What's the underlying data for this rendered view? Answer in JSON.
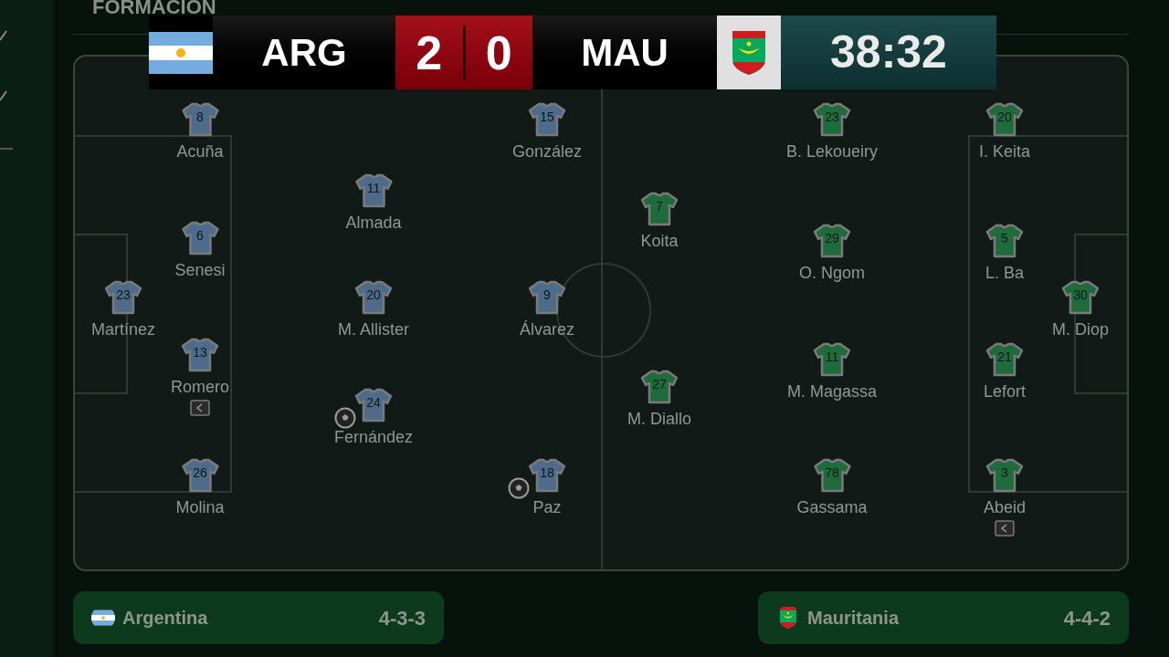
{
  "section_title": "FORMACION",
  "scoreboard": {
    "home": {
      "code": "ARG",
      "score": "2"
    },
    "away": {
      "code": "MAU",
      "score": "0"
    },
    "clock": "38:32"
  },
  "teams": [
    {
      "kind": "home",
      "name": "Argentina",
      "formation": "4-3-3",
      "lines": [
        [
          {
            "kind": "plain",
            "number": "23",
            "name": "Martínez"
          }
        ],
        [
          {
            "kind": "plain",
            "number": "8",
            "name": "Acuña"
          },
          {
            "kind": "plain",
            "number": "6",
            "name": "Senesi"
          },
          {
            "kind": "sub",
            "number": "13",
            "name": "Romero"
          },
          {
            "kind": "plain",
            "number": "26",
            "name": "Molina"
          }
        ],
        [
          {
            "kind": "plain",
            "number": "11",
            "name": "Almada"
          },
          {
            "kind": "plain",
            "number": "20",
            "name": "M. Allister"
          },
          {
            "kind": "goal",
            "number": "24",
            "name": "Fernández"
          }
        ],
        [
          {
            "kind": "plain",
            "number": "15",
            "name": "González"
          },
          {
            "kind": "plain",
            "number": "9",
            "name": "Álvarez"
          },
          {
            "kind": "goal",
            "number": "18",
            "name": "Paz"
          }
        ]
      ]
    },
    {
      "kind": "away",
      "name": "Mauritania",
      "formation": "4-4-2",
      "lines": [
        [
          {
            "kind": "plain",
            "number": "7",
            "name": "Koita"
          },
          {
            "kind": "plain",
            "number": "27",
            "name": "M. Diallo"
          }
        ],
        [
          {
            "kind": "plain",
            "number": "23",
            "name": "B. Lekoueiry"
          },
          {
            "kind": "plain",
            "number": "29",
            "name": "O. Ngom"
          },
          {
            "kind": "plain",
            "number": "11",
            "name": "M. Magassa"
          },
          {
            "kind": "plain",
            "number": "78",
            "name": "Gassama"
          }
        ],
        [
          {
            "kind": "plain",
            "number": "20",
            "name": "I. Keita"
          },
          {
            "kind": "plain",
            "number": "5",
            "name": "L. Ba"
          },
          {
            "kind": "plain",
            "number": "21",
            "name": "Lefort"
          },
          {
            "kind": "sub",
            "number": "3",
            "name": "Abeid"
          }
        ],
        [
          {
            "kind": "plain",
            "number": "30",
            "name": "M. Diop"
          }
        ]
      ]
    }
  ]
}
